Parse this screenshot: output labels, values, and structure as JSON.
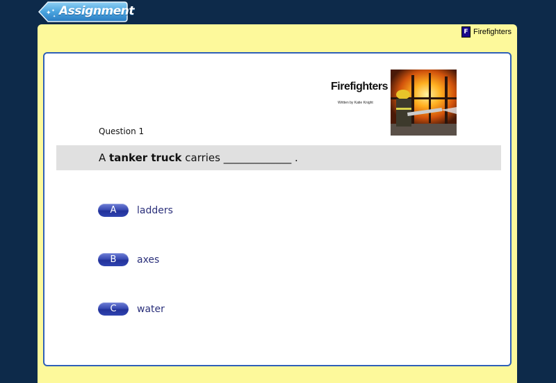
{
  "header": {
    "back_button_label": "Assignment"
  },
  "book": {
    "badge_letter": "F",
    "name": "Firefighters",
    "cover_title": "Firefighters",
    "cover_author": "Written by Katie Knight"
  },
  "question": {
    "number_label": "Question 1",
    "prefix": "A ",
    "bold_term": "tanker truck",
    "suffix": " carries _____________ ."
  },
  "answers": [
    {
      "letter": "A",
      "text": "ladders"
    },
    {
      "letter": "B",
      "text": "axes"
    },
    {
      "letter": "C",
      "text": "water"
    }
  ],
  "colors": {
    "background": "#0d2a4a",
    "panel": "#fdf99b",
    "card_border": "#2e5fb8",
    "question_bar": "#e0e0e0",
    "answer_pill": "#3a4cb4",
    "answer_text": "#2a2f7a"
  }
}
